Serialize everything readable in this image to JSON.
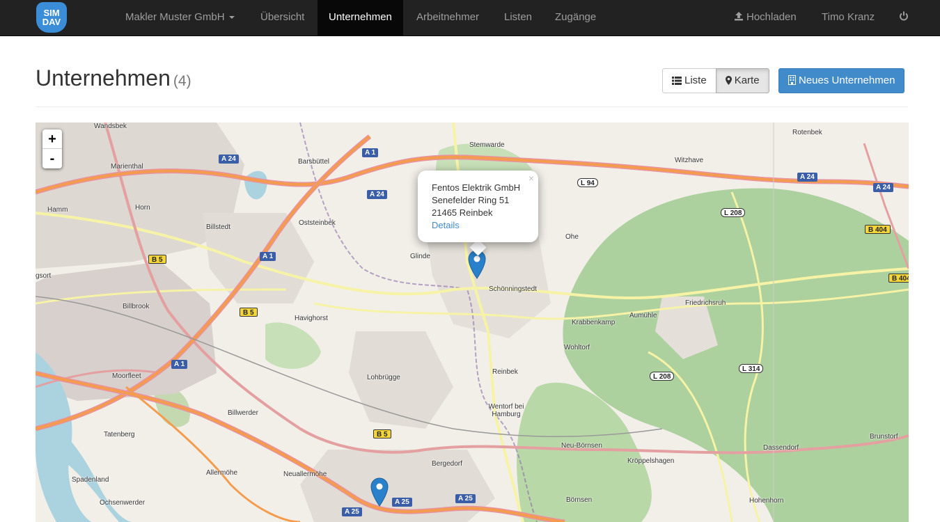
{
  "navbar": {
    "logo_line1": "SIM",
    "logo_line2": "DAV",
    "company": "Makler Muster GmbH",
    "items": [
      "Übersicht",
      "Unternehmen",
      "Arbeitnehmer",
      "Listen",
      "Zugänge"
    ],
    "active": "Unternehmen",
    "upload": "Hochladen",
    "user": "Timo Kranz"
  },
  "header": {
    "title": "Unternehmen",
    "count": "(4)",
    "view_list": "Liste",
    "view_map": "Karte",
    "new_button": "Neues Unternehmen"
  },
  "map": {
    "zoom_in": "+",
    "zoom_out": "-",
    "popup": {
      "name": "Fentos Elektrik GmbH",
      "street": "Senefelder Ring 51",
      "city": "21465 Reinbek",
      "link": "Details",
      "close": "×"
    },
    "places": [
      "Wandsbek",
      "Marienthal",
      "Hamm",
      "Horn",
      "Billstedt",
      "Barsbüttel",
      "Oststeinbek",
      "Stemwarde",
      "Glinde",
      "Schönningstedt",
      "Ohe",
      "Witzhave",
      "Rotenbek",
      "Billbrook",
      "Havighorst",
      "Friedrichsruh",
      "Krabbenkamp",
      "Aumühle",
      "Wohltorf",
      "Moorfleet",
      "Lohbrügge",
      "Reinbek",
      "Wentorf bei Hamburg",
      "Billwerder",
      "Tatenberg",
      "Bergedorf",
      "Neu-Börnsen",
      "Kröppelshagen",
      "Dassendorf",
      "Brunstorf",
      "Allermöhe",
      "Neuallermöhe",
      "Spadenland",
      "Ochsenwerder",
      "Börnsen",
      "Hohenhorn",
      "gsort"
    ],
    "shields": [
      "A 1",
      "A 24",
      "A 24",
      "A 24",
      "A 24",
      "A 1",
      "A 1",
      "A 25",
      "A 25",
      "A 25",
      "B 5",
      "B 5",
      "B 5",
      "B 404",
      "B 404",
      "L 94",
      "L 208",
      "L 208",
      "L 314"
    ]
  }
}
